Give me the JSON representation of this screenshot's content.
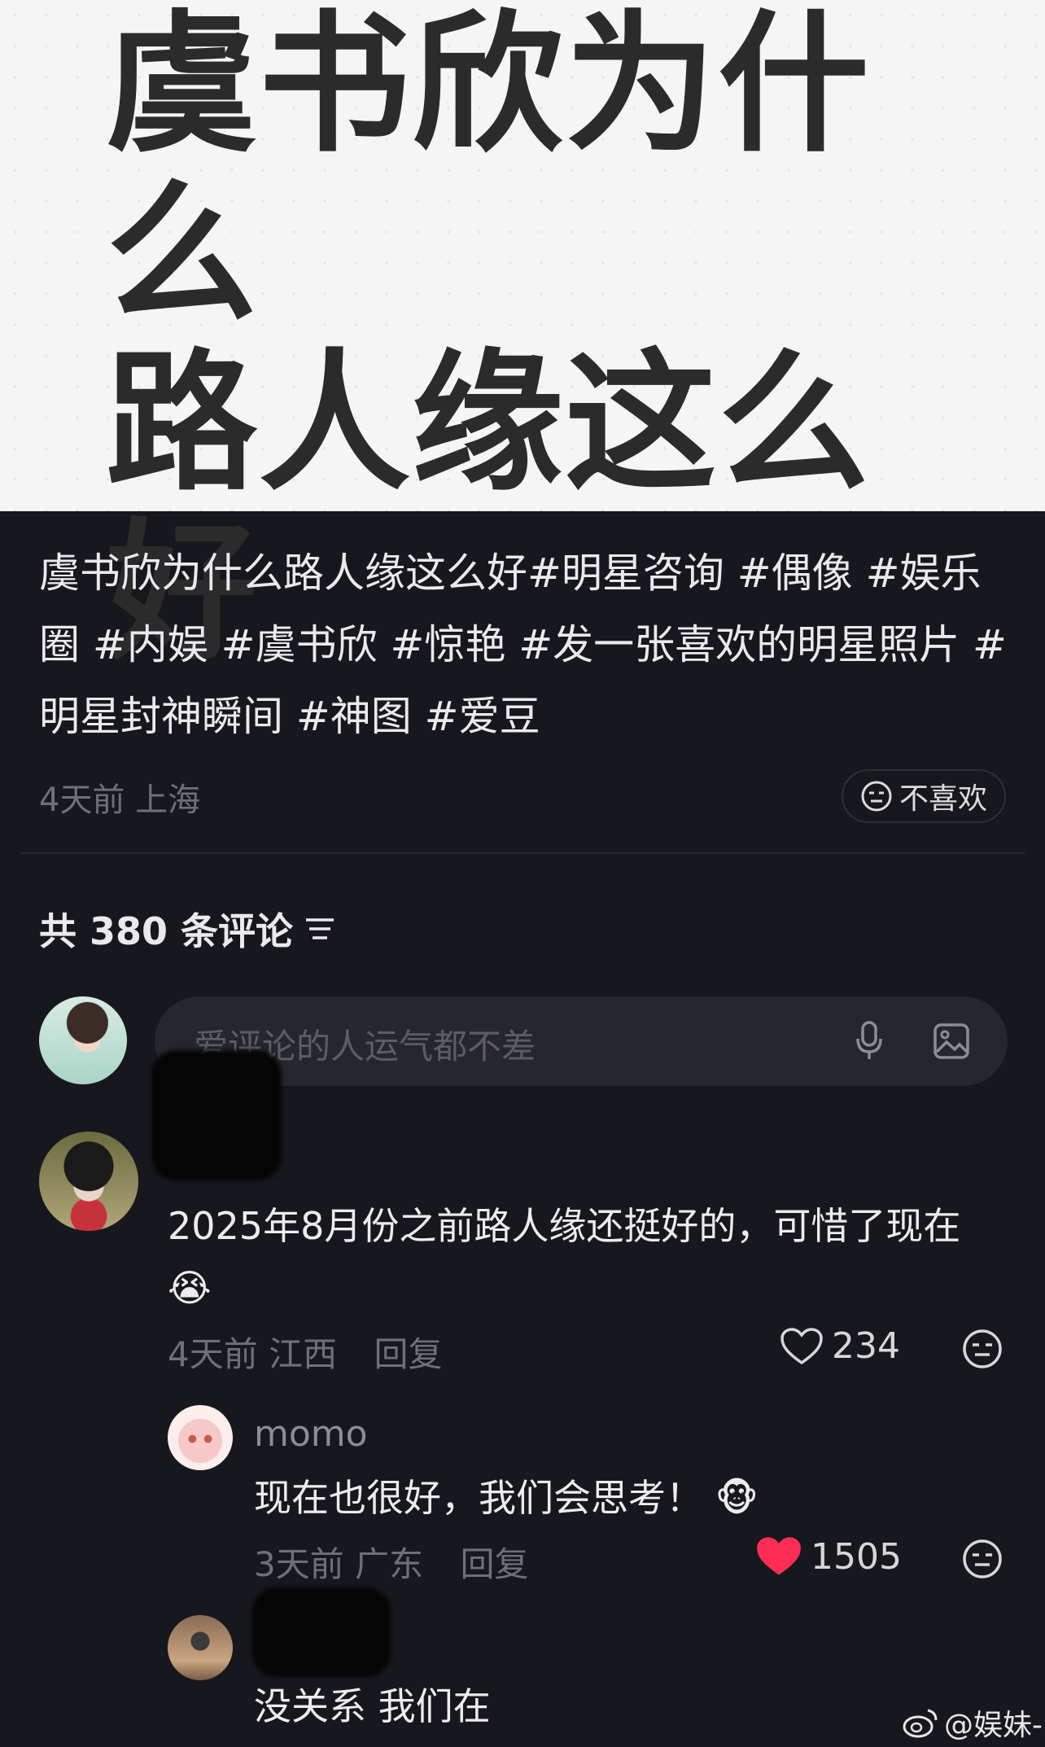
{
  "post": {
    "image_title": "虞书欣为什么\n路人缘这么好",
    "text": "虞书欣为什么路人缘这么好#明星咨询 #偶像 #娱乐圈 #内娱 #虞书欣 #惊艳 #发一张喜欢的明星照片 #明星封神瞬间 #神图 #爱豆",
    "meta": "4天前 上海",
    "dislike_label": "不喜欢"
  },
  "comments_header": {
    "label": "共 380 条评论"
  },
  "composer": {
    "placeholder": "爱评论的人运气都不差"
  },
  "comments": [
    {
      "text": "2025年8月份之前路人缘还挺好的，可惜了现在",
      "emoji": "😭",
      "time_location": "4天前 江西",
      "reply_label": "回复",
      "likes": "234",
      "liked": false
    },
    {
      "username": "momo",
      "text": "现在也很好，我们会思考！",
      "emoji": "🐵",
      "time_location": "3天前 广东",
      "reply_label": "回复",
      "likes": "1505",
      "liked": true
    },
    {
      "text": "没关系 我们在"
    }
  ],
  "watermark": {
    "text": "@娱妹-"
  },
  "colors": {
    "background": "#17181d",
    "like_red": "#ff2d55",
    "muted": "#6f6f78"
  }
}
